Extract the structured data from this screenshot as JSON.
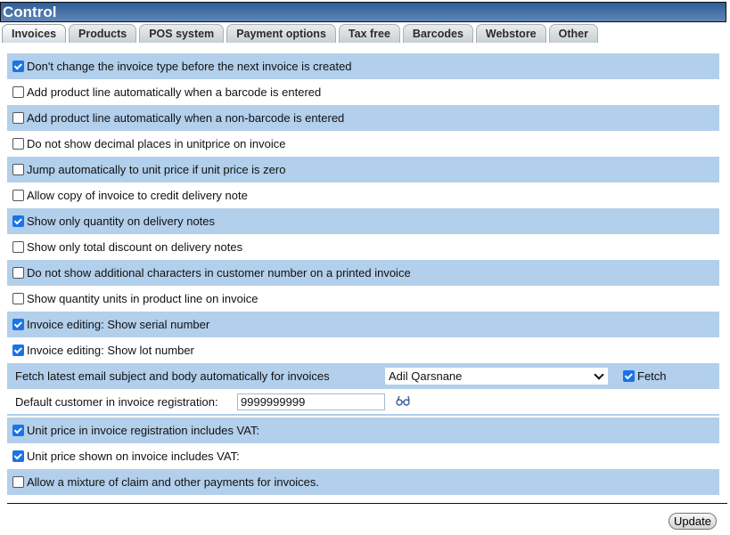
{
  "window": {
    "title": "Control"
  },
  "tabs": [
    {
      "label": "Invoices",
      "active": true
    },
    {
      "label": "Products",
      "active": false
    },
    {
      "label": "POS system",
      "active": false
    },
    {
      "label": "Payment options",
      "active": false
    },
    {
      "label": "Tax free",
      "active": false
    },
    {
      "label": "Barcodes",
      "active": false
    },
    {
      "label": "Webstore",
      "active": false
    },
    {
      "label": "Other",
      "active": false
    }
  ],
  "options_top": [
    {
      "label": "Don't change the invoice type before the next invoice is created",
      "checked": true
    },
    {
      "label": "Add product line automatically when a barcode is entered",
      "checked": false
    },
    {
      "label": "Add product line automatically when a non-barcode is entered",
      "checked": false
    },
    {
      "label": "Do not show decimal places in unitprice on invoice",
      "checked": false
    },
    {
      "label": "Jump automatically to unit price if unit price is zero",
      "checked": false
    },
    {
      "label": "Allow copy of invoice to credit delivery note",
      "checked": false
    },
    {
      "label": "Show only quantity on delivery notes",
      "checked": true
    },
    {
      "label": "Show only total discount on delivery notes",
      "checked": false
    },
    {
      "label": "Do not show additional characters in customer number on a printed invoice",
      "checked": false
    },
    {
      "label": "Show quantity units in product line on invoice",
      "checked": false
    },
    {
      "label": "Invoice editing: Show serial number",
      "checked": true
    },
    {
      "label": "Invoice editing: Show lot number",
      "checked": true
    }
  ],
  "fetch": {
    "label": "Fetch latest email subject and body automatically for invoices",
    "selected_user": "Adil Qarsnane",
    "checkbox_label": "Fetch",
    "checked": true
  },
  "default_customer": {
    "label": "Default customer in invoice registration:",
    "value": "9999999999",
    "lookup_icon": "glasses-icon"
  },
  "options_bottom": [
    {
      "label": "Unit price in invoice registration includes VAT:",
      "checked": true
    },
    {
      "label": "Unit price shown on invoice includes VAT:",
      "checked": true
    },
    {
      "label": "Allow a mixture of claim and other payments for invoices.",
      "checked": false
    }
  ],
  "footer": {
    "update_label": "Update"
  },
  "colors": {
    "row_shade": "#b2cfeb",
    "title_bar": "#2f5e97",
    "checkbox_checked": "#1a73e8"
  }
}
